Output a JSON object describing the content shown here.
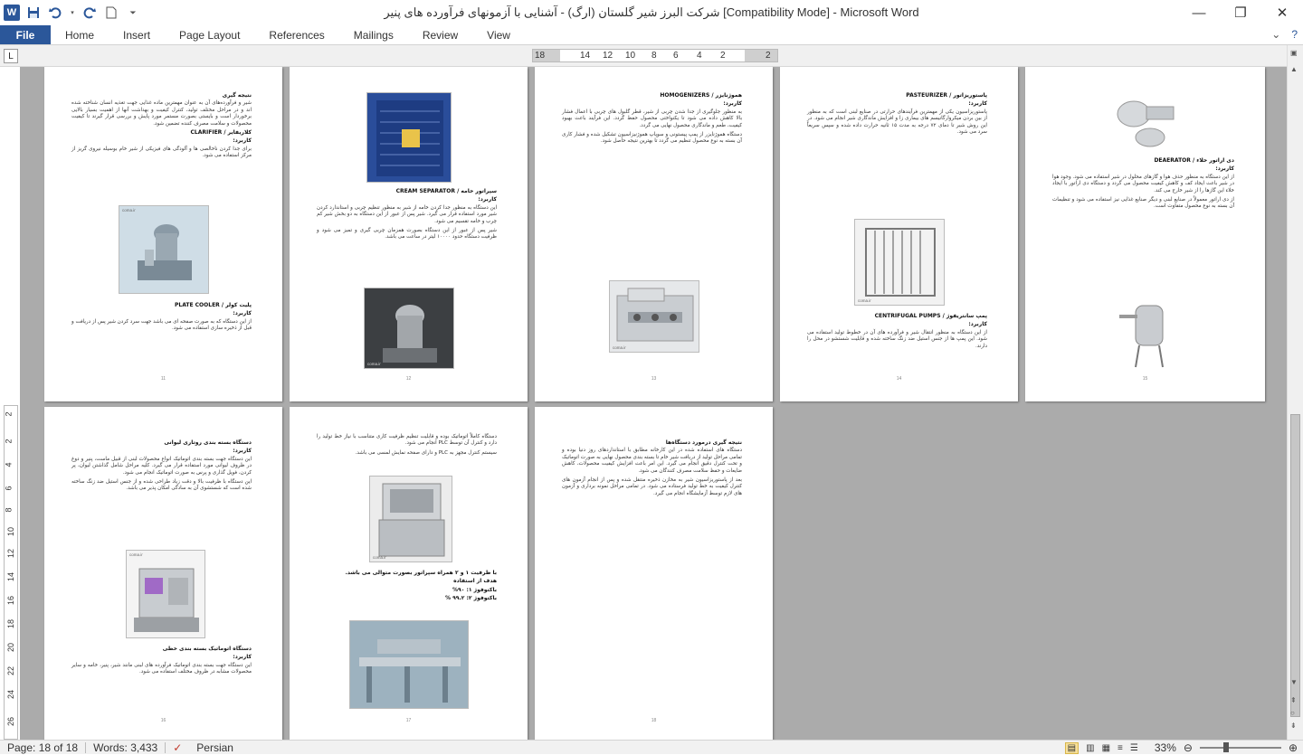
{
  "app": {
    "title": "شرکت البرز شیر گلستان (ارگ) - آشنایی با آزمونهای فرآورده های پنیر [Compatibility Mode] - Microsoft Word",
    "word_icon": "W",
    "qat_icons": [
      "save-icon",
      "undo-icon",
      "redo-icon",
      "new-document-icon",
      "customize-qat-icon"
    ]
  },
  "window": {
    "minimize": "—",
    "restore": "❐",
    "close": "✕"
  },
  "ribbon": {
    "file_tab": "File",
    "tabs": [
      "Home",
      "Insert",
      "Page Layout",
      "References",
      "Mailings",
      "Review",
      "View"
    ],
    "right_icons": [
      "ribbon-collapse-icon",
      "help-icon"
    ]
  },
  "ruler": {
    "h_numbers": [
      "18",
      "14",
      "12",
      "10",
      "8",
      "6",
      "4",
      "2",
      "2"
    ],
    "v_numbers": [
      "2",
      "2",
      "4",
      "6",
      "8",
      "10",
      "12",
      "14",
      "16",
      "18",
      "20",
      "22",
      "24",
      "26"
    ]
  },
  "pages": [
    {
      "number": "11",
      "heading1": "نتیجه گیری",
      "body1": "شیر و فرآورده‌های آن به عنوان مهمترین ماده غذایی جهت تغذیه انسان شناخته شده اند و در مراحل مختلف تولید، کنترل کیفیت و بهداشت آنها از اهمیت بسیار بالایی برخوردار است و بایستی بصورت مستمر مورد پایش و بررسی قرار گیرند تا کیفیت محصولات و سلامت مصرف کننده تضمین شود.",
      "heading2": "کلاریفایر / CLARIFIER",
      "subheading2": "کاربرد:",
      "body2": "برای جدا کردن ناخالصی ها و آلودگی های فیزیکی از شیر خام بوسیله نیروی گریز از مرکز استفاده می شود.",
      "heading3": "پلیت کولر / PLATE COOLER",
      "subheading3": "کاربرد:",
      "body3": "از این دستگاه که به صورت صفحه ای می باشد جهت سرد کردن شیر پس از دریافت و قبل از ذخیره سازی استفاده می شود."
    },
    {
      "number": "12",
      "heading1": "سپراتور خامه / CREAM SEPARATOR",
      "subheading1": "کاربرد:",
      "body1": "این دستگاه به منظور جدا کردن خامه از شیر به منظور تنظیم چربی و استاندارد کردن شیر مورد استفاده قرار می گیرد. شیر پس از عبور از این دستگاه به دو بخش شیر کم چرب و خامه تقسیم می شود.",
      "body2": "شیر پس از عبور از این دستگاه بصورت همزمان چربی گیری و تمیز می شود و ظرفیت دستگاه حدود ۱۰۰۰۰ لیتر در ساعت می باشد."
    },
    {
      "number": "13",
      "heading1": "هموژنایزر / HOMOGENIZERS",
      "subheading1": "کاربرد:",
      "body1": "به منظور جلوگیری از جدا شدن چربی از شیر، قطر گلبول های چربی با اعمال فشار بالا کاهش داده می شود تا یکنواختی محصول حفظ گردد. این فرآیند باعث بهبود کیفیت، طعم و ماندگاری محصول نهایی می گردد.",
      "body2": "دستگاه هموژنایزر از پمپ پیستونی و سوپاپ هموژنیزاسیون تشکیل شده و فشار کاری آن بسته به نوع محصول تنظیم می گردد تا بهترین نتیجه حاصل شود."
    },
    {
      "number": "14",
      "heading1": "پاستوریزاتور / PASTEURIZER",
      "subheading1": "کاربرد:",
      "body1": "پاستوریزاسیون یکی از مهمترین فرآیندهای حرارتی در صنایع لبنی است که به منظور از بین بردن میکروارگانیسم های بیماری زا و افزایش ماندگاری شیر انجام می شود. در این روش شیر تا دمای ۷۲ درجه به مدت ۱۵ ثانیه حرارت داده شده و سپس سریعاً سرد می شود.",
      "heading2": "پمپ سانتریفوژ / CENTRIFUGAL PUMPS",
      "subheading2": "کاربرد:",
      "body2": "از این دستگاه به منظور انتقال شیر و فرآورده های آن در خطوط تولید استفاده می شود. این پمپ ها از جنس استیل ضد زنگ ساخته شده و قابلیت شستشو در محل را دارند."
    },
    {
      "number": "15",
      "heading1": "دی اراتور خلاء / DEAERATOR",
      "subheading1": "کاربرد:",
      "body1": "از این دستگاه به منظور حذف هوا و گازهای محلول در شیر استفاده می شود. وجود هوا در شیر باعث ایجاد کف و کاهش کیفیت محصول می گردد و دستگاه دی اراتور با ایجاد خلاء این گازها را از شیر خارج می کند.",
      "body2": "از دی اراتور معمولاً در صنایع لبنی و دیگر صنایع غذایی نیز استفاده می شود و تنظیمات آن بسته به نوع محصول متفاوت است."
    },
    {
      "number": "16",
      "heading1": "دستگاه بسته بندی روتاری لیوانی",
      "subheading1": "کاربرد:",
      "body1": "این دستگاه جهت بسته بندی اتوماتیک انواع محصولات لبنی از قبیل ماست، پنیر و دوغ در ظروف لیوانی مورد استفاده قرار می گیرد. کلیه مراحل شامل گذاشتن لیوان، پر کردن، فویل گذاری و پرس به صورت اتوماتیک انجام می شود.",
      "body2": "این دستگاه با ظرفیت بالا و دقت زیاد طراحی شده و از جنس استیل ضد زنگ ساخته شده است که شستشوی آن به سادگی امکان پذیر می باشد.",
      "heading2": "دستگاه اتوماتیک بسته بندی خطی",
      "subheading2": "کاربرد:",
      "body3": "این دستگاه جهت بسته بندی اتوماتیک فرآورده های لبنی مانند شیر، پنیر، خامه و سایر محصولات مشابه در ظروف مختلف استفاده می شود."
    },
    {
      "number": "17",
      "body1": "دستگاه کاملاً اتوماتیک بوده و قابلیت تنظیم ظرفیت کاری متناسب با نیاز خط تولید را دارد و کنترل آن توسط PLC انجام می شود.",
      "body2": "سیستم کنترل مجهز به PLC و دارای صفحه نمایش لمسی می باشد.",
      "heading2": "با ظرفیت ۱ و ۲ همراه سپراتور بصورت متوالی می باشد.",
      "heading3": "هدف از استفاده",
      "line1": "باکتوفوژ ۱: ۹۰%",
      "line2": "باکتوفوژ ۲: ۹۹.۲ %"
    },
    {
      "number": "18",
      "heading1": "نتیجه گیری درمورد دستگاه‌ها",
      "body1": "دستگاه های استفاده شده در این کارخانه مطابق با استانداردهای روز دنیا بوده و تمامی مراحل تولید از دریافت شیر خام تا بسته بندی محصول نهایی به صورت اتوماتیک و تحت کنترل دقیق انجام می گیرد. این امر باعث افزایش کیفیت محصولات، کاهش ضایعات و حفظ سلامت مصرف کنندگان می شود.",
      "body2": "بعد از پاستوریزاسیون شیر به مخازن ذخیره منتقل شده و پس از انجام آزمون های کنترل کیفیت به خط تولید فرستاده می شود. در تمامی مراحل نمونه برداری و آزمون های لازم توسط آزمایشگاه انجام می گیرد."
    }
  ],
  "image_labels": {
    "coma": "coma.ir"
  },
  "status": {
    "page": "Page: 18 of 18",
    "words": "Words: 3,433",
    "language": "Persian",
    "zoom": "33%",
    "zoom_fraction": 0.33
  },
  "colors": {
    "accent": "#2b579a",
    "workspace": "#ababab"
  }
}
